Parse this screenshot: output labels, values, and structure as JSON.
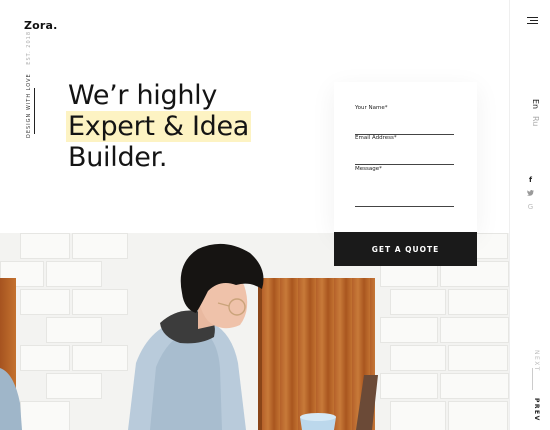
{
  "brand": {
    "logo": "Zora."
  },
  "side_tagline": {
    "main": "DESIGN WITH LOVE",
    "secondary": "EST. 2018"
  },
  "hero": {
    "line1": "We’r highly",
    "line2": "Expert & Idea",
    "line3": "Builder."
  },
  "form": {
    "name_label": "Your Name*",
    "email_label": "Email Address*",
    "message_label": "Message*",
    "submit_label": "GET A QUOTE"
  },
  "rail": {
    "lang_active": "En",
    "lang_other": "Ru",
    "social": [
      {
        "icon": "facebook-icon",
        "glyph": "f"
      },
      {
        "icon": "twitter-icon",
        "glyph": "t"
      },
      {
        "icon": "google-icon",
        "glyph": "G"
      }
    ],
    "next_label": "NEXT",
    "prev_label": "PREV"
  },
  "colors": {
    "highlight": "#fdf3c3",
    "button_bg": "#1a1a1a"
  }
}
